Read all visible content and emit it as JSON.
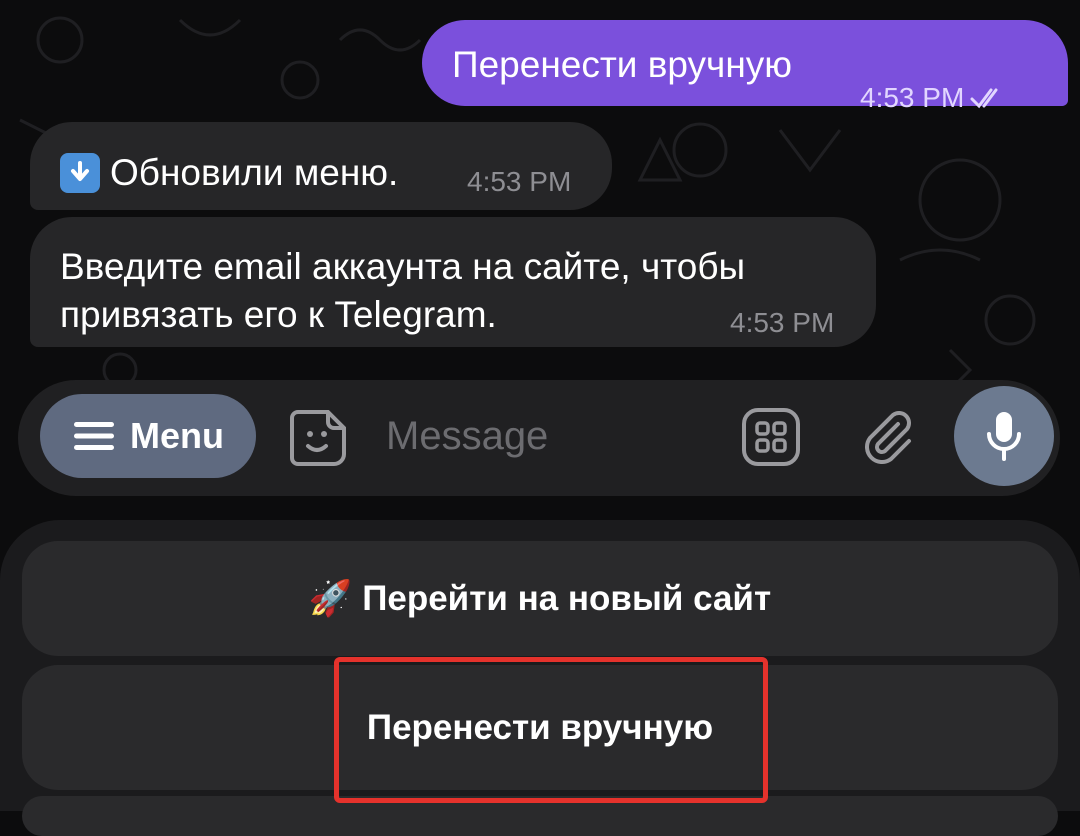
{
  "messages": {
    "outgoing": {
      "text": "Перенести вручную",
      "time": "4:53 PM"
    },
    "incoming_1": {
      "emoji": "⬇️",
      "text": "Обновили меню.",
      "time": "4:53 PM"
    },
    "incoming_2": {
      "line1": "Введите email аккаунта на сайте, чтобы",
      "line2": "привязать его к Telegram.",
      "time": "4:53 PM"
    }
  },
  "composer": {
    "menu_label": "Menu",
    "placeholder": "Message"
  },
  "keyboard": {
    "buttons": [
      {
        "emoji": "🚀",
        "label": "Перейти на новый сайт"
      },
      {
        "label": "Перенести вручную"
      }
    ]
  },
  "colors": {
    "outgoing_bubble": "#7b50dc",
    "incoming_bubble": "#262628",
    "highlight": "#e5322c",
    "menu_button": "#5f6a80"
  }
}
